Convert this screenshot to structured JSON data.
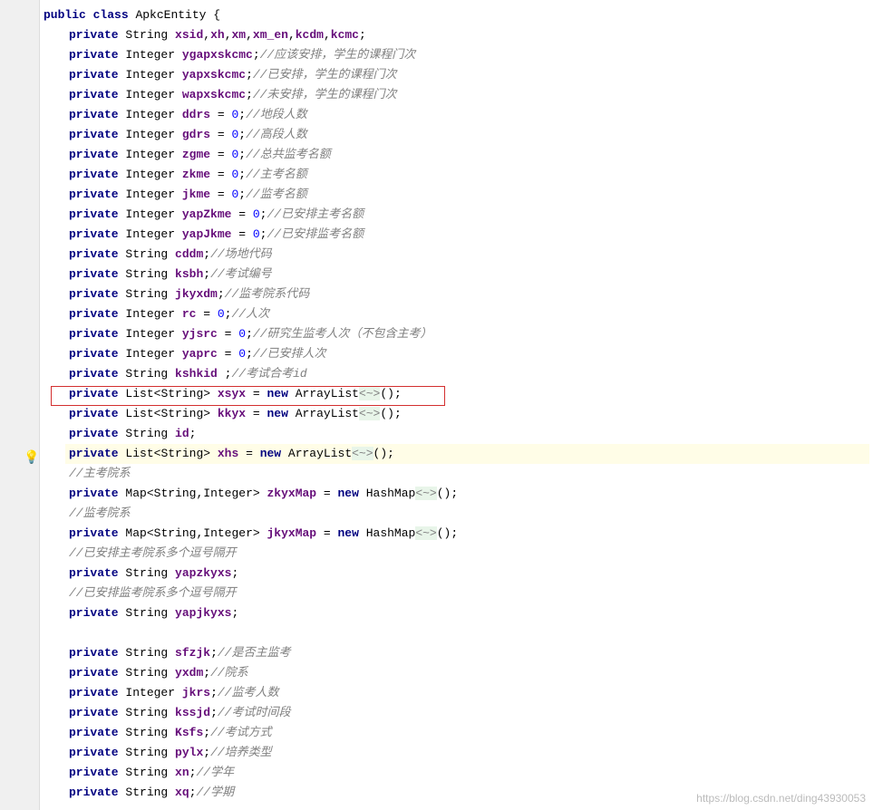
{
  "kw": {
    "public": "public",
    "class": "class",
    "private": "private",
    "new": "new"
  },
  "types": {
    "String": "String",
    "Integer": "Integer",
    "List": "List",
    "ArrayList": "ArrayList",
    "Map": "Map",
    "HashMap": "HashMap"
  },
  "className": "ApkcEntity",
  "diamond": "<~>",
  "zero": "0",
  "lines": [
    {
      "type": "classdef"
    },
    {
      "type": "field_multi",
      "t": "String",
      "names": "xsid,xh,xm,xm_en,kcdm,kcmc",
      "end": ";"
    },
    {
      "type": "field",
      "t": "Integer",
      "name": "ygapxskcmc",
      "end": ";",
      "cmt": "//应该安排，学生的课程门次"
    },
    {
      "type": "field",
      "t": "Integer",
      "name": "yapxskcmc",
      "end": ";",
      "cmt": "//已安排，学生的课程门次"
    },
    {
      "type": "field",
      "t": "Integer",
      "name": "wapxskcmc",
      "end": ";",
      "cmt": "//未安排，学生的课程门次"
    },
    {
      "type": "field_init0",
      "t": "Integer",
      "name": "ddrs",
      "cmt": "//地段人数"
    },
    {
      "type": "field_init0",
      "t": "Integer",
      "name": "gdrs",
      "cmt": "//高段人数"
    },
    {
      "type": "field_init0",
      "t": "Integer",
      "name": "zgme",
      "cmt": "//总共监考名额"
    },
    {
      "type": "field_init0",
      "t": "Integer",
      "name": "zkme",
      "cmt": "//主考名额"
    },
    {
      "type": "field_init0",
      "t": "Integer",
      "name": "jkme",
      "cmt": "//监考名额"
    },
    {
      "type": "field_init0",
      "t": "Integer",
      "name": "yapZkme",
      "cmt": "//已安排主考名额"
    },
    {
      "type": "field_init0",
      "t": "Integer",
      "name": "yapJkme",
      "cmt": "//已安排监考名额"
    },
    {
      "type": "field",
      "t": "String",
      "name": "cddm",
      "end": ";",
      "cmt": "//场地代码"
    },
    {
      "type": "field",
      "t": "String",
      "name": "ksbh",
      "end": ";",
      "cmt": "//考试编号"
    },
    {
      "type": "field",
      "t": "String",
      "name": "jkyxdm",
      "end": ";",
      "cmt": "//监考院系代码"
    },
    {
      "type": "field_init0",
      "t": "Integer",
      "name": "rc",
      "cmt": "//人次"
    },
    {
      "type": "field_init0",
      "t": "Integer",
      "name": "yjsrc",
      "cmt": "//研究生监考人次（不包含主考）"
    },
    {
      "type": "field_init0",
      "t": "Integer",
      "name": "yaprc",
      "cmt": "//已安排人次"
    },
    {
      "type": "field",
      "t": "String",
      "name": "kshkid ",
      "end": ";",
      "cmt": "//考试合考id"
    },
    {
      "type": "list_init",
      "name": "xsyx"
    },
    {
      "type": "list_init",
      "name": "kkyx"
    },
    {
      "type": "field",
      "t": "String",
      "name": "id",
      "end": ";"
    },
    {
      "type": "list_init",
      "name": "xhs",
      "hl": true
    },
    {
      "type": "cmt_only",
      "cmt": "//主考院系"
    },
    {
      "type": "map_init",
      "name": "zkyxMap"
    },
    {
      "type": "cmt_only",
      "cmt": "//监考院系"
    },
    {
      "type": "map_init",
      "name": "jkyxMap"
    },
    {
      "type": "cmt_only",
      "cmt": "//已安排主考院系多个逗号隔开"
    },
    {
      "type": "field",
      "t": "String",
      "name": "yapzkyxs",
      "end": ";"
    },
    {
      "type": "cmt_only",
      "cmt": "//已安排监考院系多个逗号隔开"
    },
    {
      "type": "field",
      "t": "String",
      "name": "yapjkyxs",
      "end": ";"
    },
    {
      "type": "blank"
    },
    {
      "type": "field",
      "t": "String",
      "name": "sfzjk",
      "end": ";",
      "cmt": "//是否主监考"
    },
    {
      "type": "field",
      "t": "String",
      "name": "yxdm",
      "end": ";",
      "cmt": "//院系"
    },
    {
      "type": "field",
      "t": "Integer",
      "name": "jkrs",
      "end": ";",
      "cmt": "//监考人数"
    },
    {
      "type": "field",
      "t": "String",
      "name": "kssjd",
      "end": ";",
      "cmt": "//考试时间段"
    },
    {
      "type": "field",
      "t": "String",
      "name": "Ksfs",
      "end": ";",
      "cmt": "//考试方式"
    },
    {
      "type": "field",
      "t": "String",
      "name": "pylx",
      "end": ";",
      "cmt": "//培养类型"
    },
    {
      "type": "field",
      "t": "String",
      "name": "xn",
      "end": ";",
      "cmt": "//学年"
    },
    {
      "type": "field",
      "t": "String",
      "name": "xq",
      "end": ";",
      "cmt": "//学期"
    }
  ],
  "watermark": "https://blog.csdn.net/ding43930053"
}
